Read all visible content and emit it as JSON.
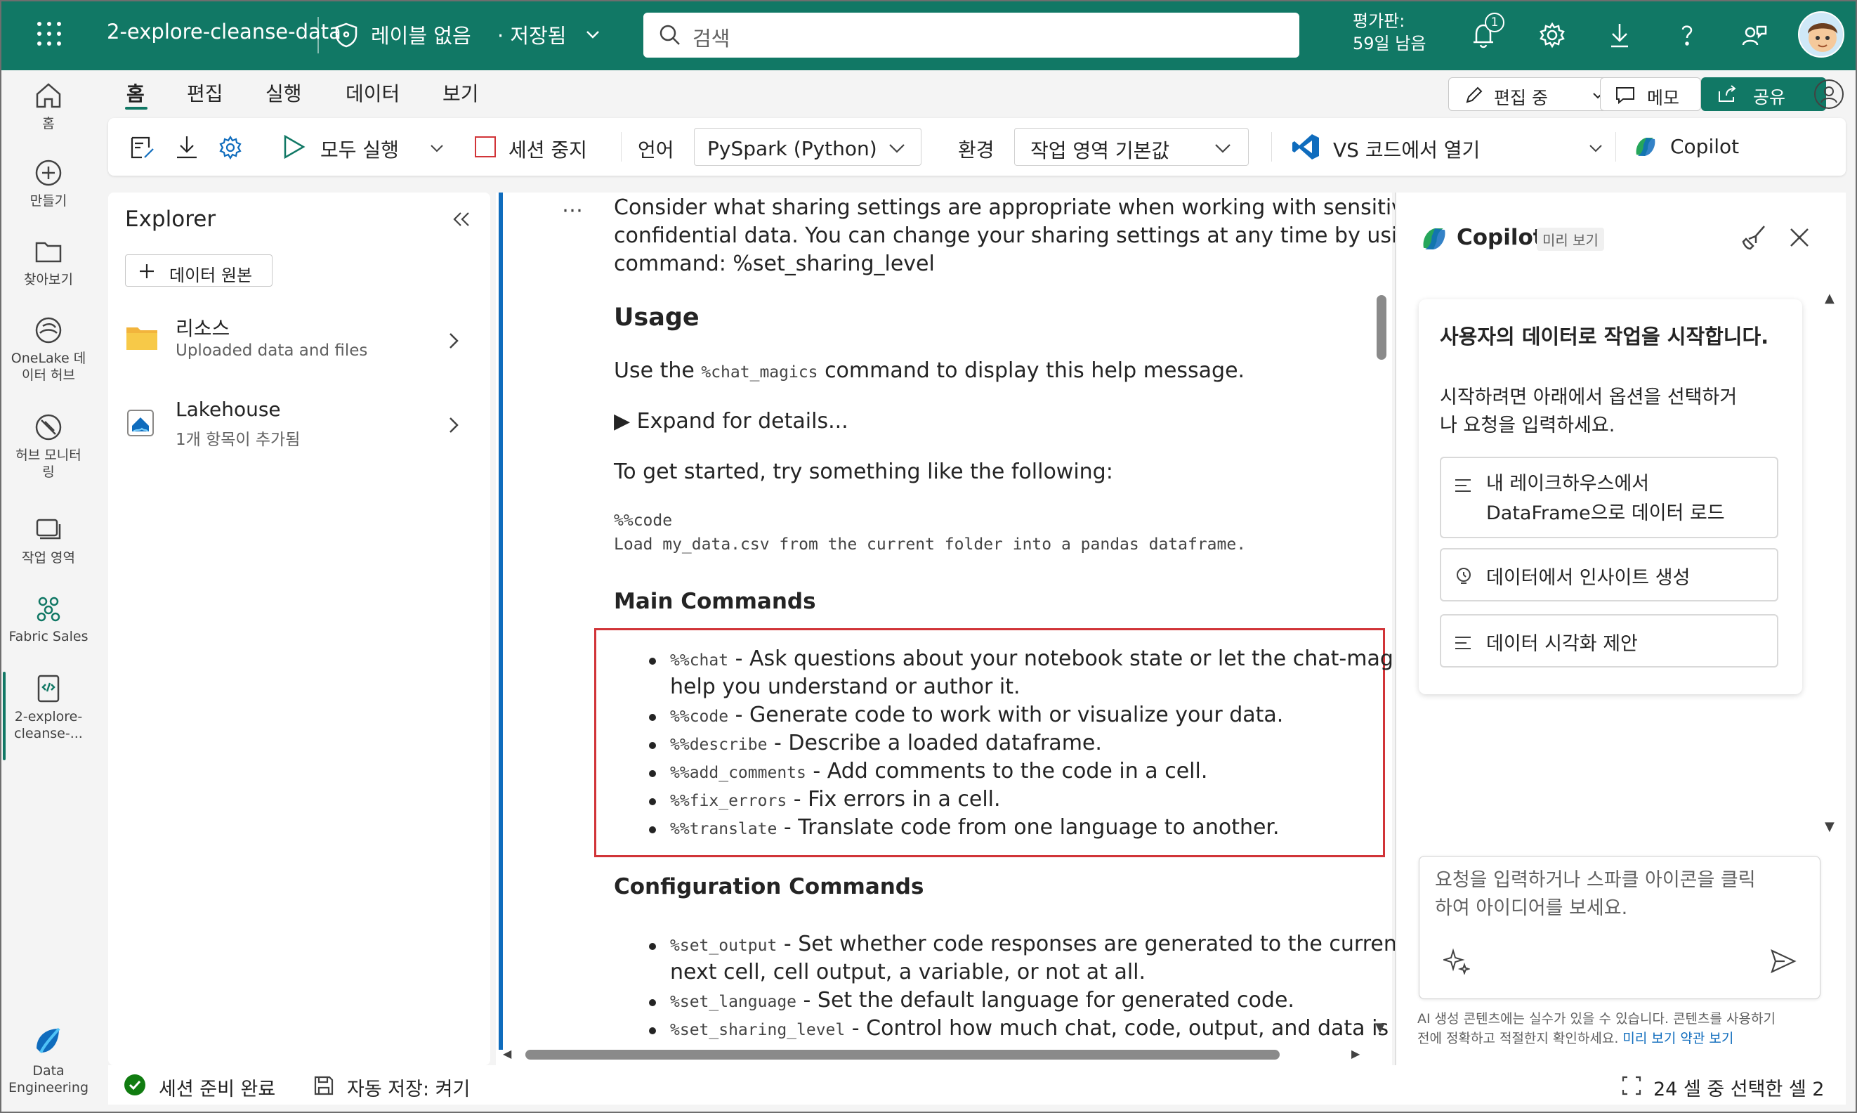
{
  "topbar": {
    "notebook_name": "2-explore-cleanse-data",
    "label": "레이블 없음",
    "saved": "· 저장됨",
    "search_placeholder": "검색",
    "trial_line1": "평가판:",
    "trial_line2": "59일 남음",
    "notification_count": "1"
  },
  "rail": {
    "items": [
      {
        "label": "홈",
        "icon": "home-icon"
      },
      {
        "label": "만들기",
        "icon": "plus-circle-icon"
      },
      {
        "label": "찾아보기",
        "icon": "folder-icon"
      },
      {
        "label": "OneLake 데이터 허브",
        "icon": "onelake-icon"
      },
      {
        "label": "허브 모니터링",
        "icon": "monitor-icon"
      },
      {
        "label": "작업 영역",
        "icon": "workspace-icon"
      },
      {
        "label": "Fabric Sales",
        "icon": "fabric-sales-icon"
      },
      {
        "label": "2-explore-cleanse-...",
        "icon": "notebook-icon"
      }
    ],
    "bottom_label_1": "Data",
    "bottom_label_2": "Engineering"
  },
  "menu_tabs": [
    "홈",
    "편집",
    "실행",
    "데이터",
    "보기"
  ],
  "header_buttons": {
    "editing": "편집 중",
    "memo": "메모",
    "share": "공유"
  },
  "ribbon": {
    "run_all": "모두 실행",
    "stop_session": "세션 중지",
    "language_label": "언어",
    "language_value": "PySpark (Python)",
    "environment_label": "환경",
    "environment_value": "작업 영역 기본값",
    "vscode": "VS 코드에서 열기",
    "copilot": "Copilot"
  },
  "explorer": {
    "title": "Explorer",
    "add_source": "데이터 원본",
    "resources_title": "리소스",
    "resources_sub": "Uploaded data and files",
    "lakehouse_title": "Lakehouse",
    "lakehouse_sub": "1개 항목이 추가됨"
  },
  "editor": {
    "intro_line1": "Consider what sharing settings are appropriate when working with sensitive o",
    "intro_line2": "confidential data. You can change your sharing settings at any time by using",
    "intro_line3": "command: %set_sharing_level",
    "usage_heading": "Usage",
    "usage_pre": "Use the ",
    "usage_code": "%chat_magics",
    "usage_post": " command to display this help message.",
    "expand": "▶ Expand for details...",
    "get_started": "To get started, try something like the following:",
    "code_line1": "%%code",
    "code_line2": "Load my_data.csv from the current folder into a pandas dataframe.",
    "main_heading": "Main Commands",
    "main_commands": [
      {
        "cmd": "%%chat",
        "desc": " - Ask questions about your notebook state or let the chat-magic",
        "cont": "help you understand or author it."
      },
      {
        "cmd": "%%code",
        "desc": " - Generate code to work with or visualize your data."
      },
      {
        "cmd": "%%describe",
        "desc": " - Describe a loaded dataframe."
      },
      {
        "cmd": "%%add_comments",
        "desc": " - Add comments to the code in a cell."
      },
      {
        "cmd": "%%fix_errors",
        "desc": " - Fix errors in a cell."
      },
      {
        "cmd": "%%translate",
        "desc": " - Translate code from one language to another."
      }
    ],
    "config_heading": "Configuration Commands",
    "config_commands": [
      {
        "cmd": "%set_output",
        "desc": " - Set whether code responses are generated to the current c",
        "cont": "next cell, cell output, a variable, or not at all."
      },
      {
        "cmd": "%set_language",
        "desc": " - Set the default language for generated code."
      },
      {
        "cmd": "%set_sharing_level",
        "desc": " - Control how much chat, code, output, and data is"
      }
    ]
  },
  "copilot": {
    "title": "Copilot",
    "badge": "미리 보기",
    "card_title": "사용자의 데이터로 작업을 시작합니다.",
    "card_body_1": "시작하려면 아래에서 옵션을 선택하거",
    "card_body_2": "나 요청을 입력하세요.",
    "options": [
      {
        "line1": "내 레이크하우스에서",
        "line2": "DataFrame으로 데이터 로드"
      },
      {
        "line1": "데이터에서 인사이트 생성"
      },
      {
        "line1": "데이터 시각화 제안"
      }
    ],
    "input_placeholder_1": "요청을 입력하거나 스파클 아이콘을 클릭",
    "input_placeholder_2": "하여 아이디어를 보세요.",
    "disclaimer_1": "AI 생성 콘텐츠에는 실수가 있을 수 있습니다. 콘텐츠를 사용하기",
    "disclaimer_2": "전에 정확하고 적절한지 확인하세요.",
    "disclaimer_link": "미리 보기 약관 보기"
  },
  "status": {
    "session": "세션 준비 완료",
    "autosave": "자동 저장: 켜기",
    "cells": "24 셀 중 선택한 셀 2"
  },
  "colors": {
    "brand": "#117865",
    "highlight_border": "#d13438",
    "accent_blue": "#0f6cbd"
  }
}
